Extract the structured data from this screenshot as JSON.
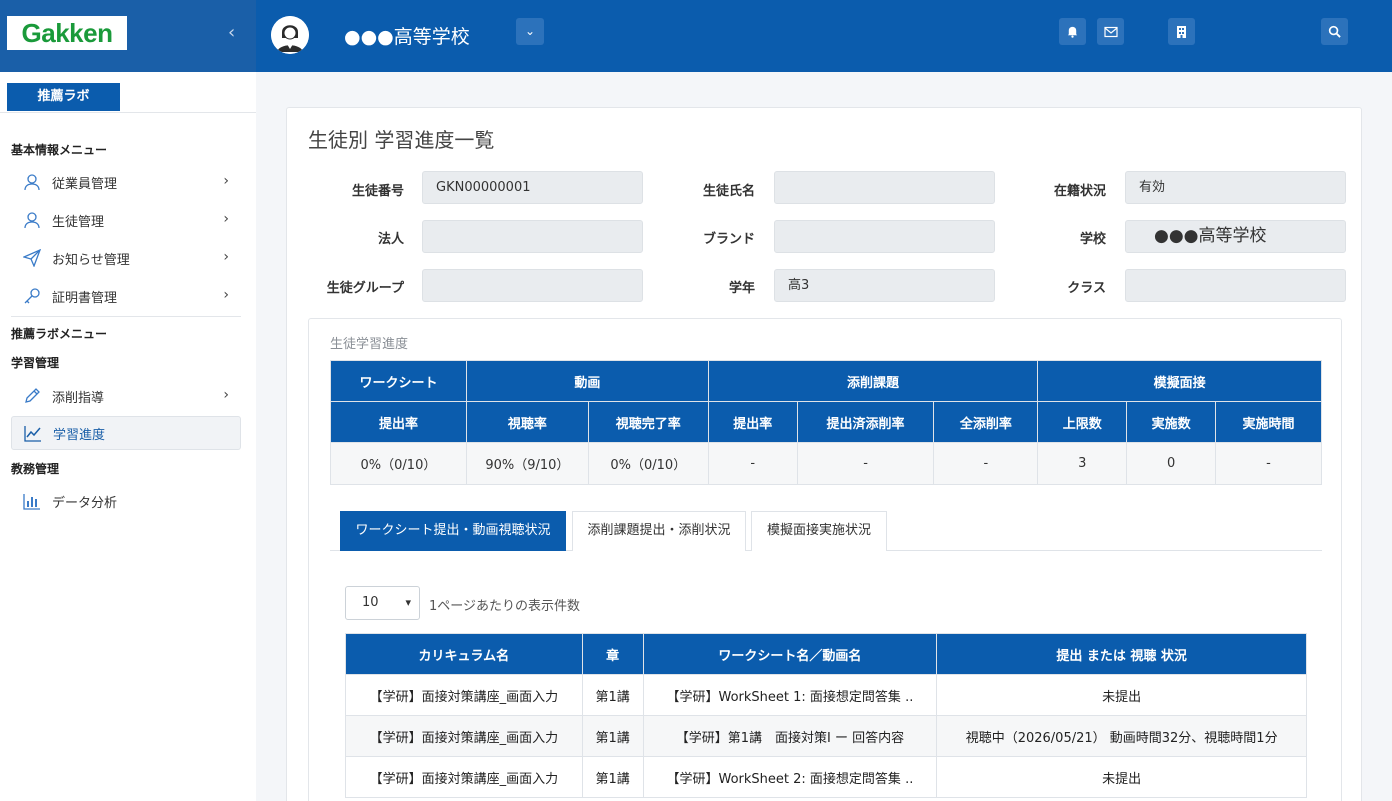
{
  "brand": {
    "logo_text": "Gakken"
  },
  "header": {
    "school_name": "●●●高等学校"
  },
  "sidebar": {
    "lab_button": "推薦ラボ",
    "basic_menu_title": "基本情報メニュー",
    "basic_items": [
      {
        "label": "従業員管理"
      },
      {
        "label": "生徒管理"
      },
      {
        "label": "お知らせ管理"
      },
      {
        "label": "証明書管理"
      }
    ],
    "lab_menu_title": "推薦ラボメニュー",
    "study_section": "学習管理",
    "study_items": [
      {
        "label": "添削指導"
      },
      {
        "label": "学習進度"
      }
    ],
    "affairs_section": "教務管理",
    "affairs_items": [
      {
        "label": "データ分析"
      }
    ]
  },
  "page": {
    "title": "生徒別 学習進度一覧"
  },
  "student": {
    "number_label": "生徒番号",
    "number_value": "GKN00000001",
    "name_label": "生徒氏名",
    "name_value": "",
    "enroll_label": "在籍状況",
    "enroll_value": "有効",
    "corp_label": "法人",
    "corp_value": "",
    "brand_label": "ブランド",
    "brand_value": "",
    "school_label": "学校",
    "school_value": "●●●高等学校",
    "group_label": "生徒グループ",
    "group_value": "",
    "grade_label": "学年",
    "grade_value": "高3",
    "class_label": "クラス",
    "class_value": ""
  },
  "progress": {
    "title": "生徒学習進度",
    "groups": [
      "ワークシート",
      "動画",
      "添削課題",
      "模擬面接"
    ],
    "columns": [
      "提出率",
      "視聴率",
      "視聴完了率",
      "提出率",
      "提出済添削率",
      "全添削率",
      "上限数",
      "実施数",
      "実施時間"
    ],
    "values": [
      "0%（0/10）",
      "90%（9/10）",
      "0%（0/10）",
      "-",
      "-",
      "-",
      "3",
      "0",
      "-"
    ]
  },
  "tabs": [
    {
      "label": "ワークシート提出・動画視聴状況"
    },
    {
      "label": "添削課題提出・添削状況"
    },
    {
      "label": "模擬面接実施状況"
    }
  ],
  "list_controls": {
    "page_size": "10",
    "page_size_label": "1ページあたりの表示件数"
  },
  "ws_table": {
    "headers": [
      "カリキュラム名",
      "章",
      "ワークシート名／動画名",
      "提出 または 視聴 状況"
    ],
    "rows": [
      [
        "【学研】面接対策講座_画面入力",
        "第1講",
        "【学研】WorkSheet 1: 面接想定問答集 ..",
        "未提出"
      ],
      [
        "【学研】面接対策講座_画面入力",
        "第1講",
        "【学研】第1講　面接対策Ⅰ ー 回答内容",
        "視聴中（2026/05/21） 動画時間32分、視聴時間1分"
      ],
      [
        "【学研】面接対策講座_画面入力",
        "第1講",
        "【学研】WorkSheet 2: 面接想定問答集 ..",
        "未提出"
      ]
    ]
  }
}
